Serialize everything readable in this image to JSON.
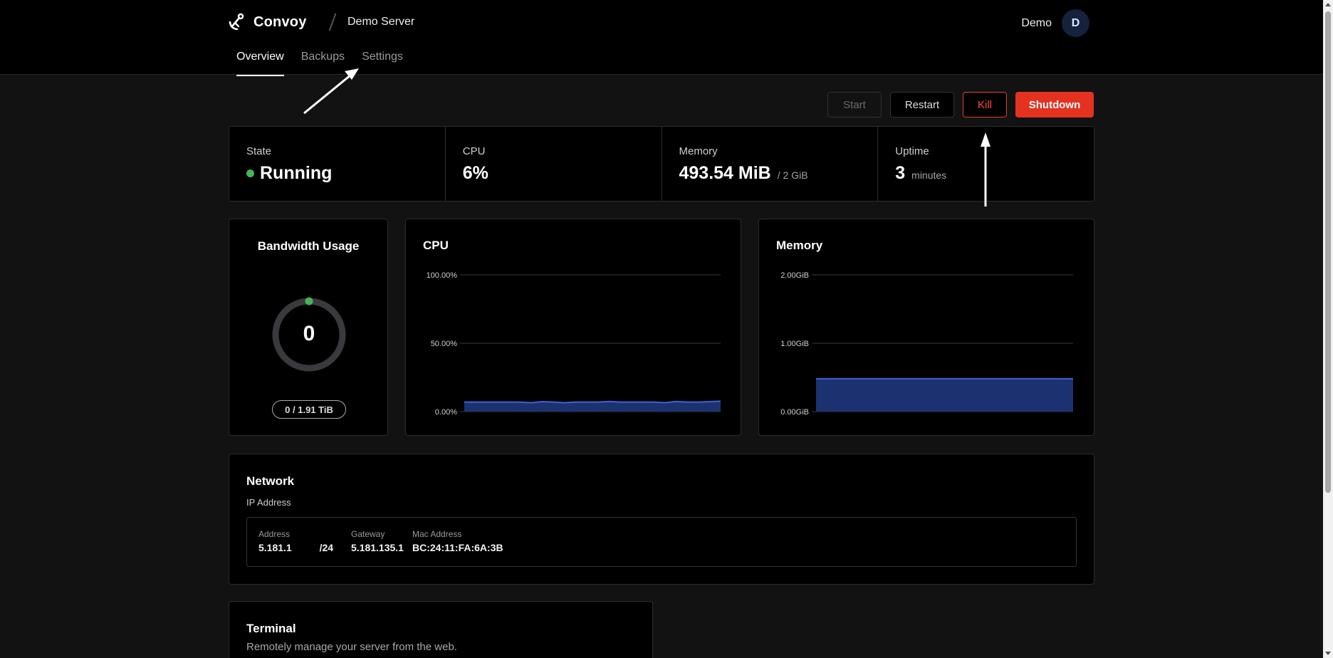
{
  "header": {
    "brand": "Convoy",
    "server_name": "Demo Server",
    "user_name": "Demo",
    "avatar_initial": "D"
  },
  "tabs": [
    {
      "label": "Overview",
      "active": true
    },
    {
      "label": "Backups",
      "active": false
    },
    {
      "label": "Settings",
      "active": false
    }
  ],
  "actions": {
    "start": "Start",
    "restart": "Restart",
    "kill": "Kill",
    "shutdown": "Shutdown"
  },
  "stats": {
    "state": {
      "label": "State",
      "value": "Running",
      "color": "#46b35a"
    },
    "cpu": {
      "label": "CPU",
      "value": "6%"
    },
    "memory": {
      "label": "Memory",
      "value": "493.54 MiB",
      "limit": "/ 2 GiB"
    },
    "uptime": {
      "label": "Uptime",
      "value": "3",
      "unit": "minutes"
    }
  },
  "bandwidth": {
    "title": "Bandwidth Usage",
    "value": "0",
    "usage": "0 / 1.91 TiB",
    "fraction_used": 0
  },
  "cpu_chart": {
    "title": "CPU",
    "y_ticks": [
      "100.00%",
      "50.00%",
      "0.00%"
    ]
  },
  "memory_chart": {
    "title": "Memory",
    "y_ticks": [
      "2.00GiB",
      "1.00GiB",
      "0.00GiB"
    ]
  },
  "chart_data": [
    {
      "type": "area",
      "title": "CPU",
      "ylim": [
        0,
        100
      ],
      "y_unit": "%",
      "series": [
        {
          "values": [
            7,
            7,
            7,
            7,
            7,
            7,
            6.5,
            7.3,
            7,
            6.5,
            7,
            7,
            7,
            7.4,
            7,
            7,
            7,
            7,
            6.5,
            7.4,
            7,
            7,
            7.3,
            7.6
          ]
        }
      ],
      "color": "#3b63d6",
      "grid": true
    },
    {
      "type": "area",
      "title": "Memory",
      "ylim": [
        0,
        2
      ],
      "y_unit": "GiB",
      "series": [
        {
          "values": [
            0.48,
            0.48,
            0.48,
            0.48,
            0.48,
            0.48,
            0.48,
            0.48,
            0.48,
            0.48
          ]
        }
      ],
      "color": "#3b63d6",
      "grid": true
    }
  ],
  "network": {
    "title": "Network",
    "subtitle": "IP Address",
    "address_label": "Address",
    "address_value": "5.181.1          /24",
    "gateway_label": "Gateway",
    "gateway_value": "5.181.135.1",
    "mac_label": "Mac Address",
    "mac_value": "BC:24:11:FA:6A:3B"
  },
  "terminal": {
    "title": "Terminal",
    "subtitle": "Remotely manage your server from the web."
  }
}
